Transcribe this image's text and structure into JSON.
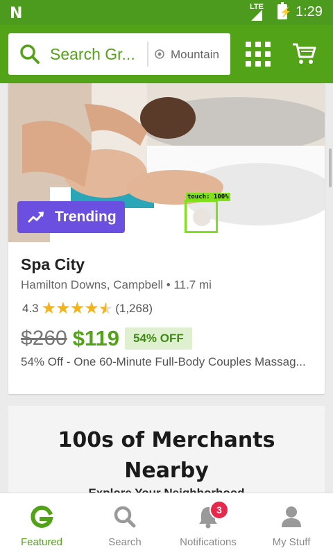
{
  "status_bar": {
    "carrier_glyph": "N",
    "network": "LTE",
    "time": "1:29"
  },
  "header": {
    "search_placeholder": "Search Gr...",
    "location": "Mountain"
  },
  "deal": {
    "badge": "Trending",
    "touch_label": "touch: 100%",
    "merchant": "Spa City",
    "location": "Hamilton Downs, Campbell • 11.7 mi",
    "rating": "4.3",
    "stars": 4.3,
    "reviews": "(1,268)",
    "original_price": "$260",
    "price": "$119",
    "discount": "54% OFF",
    "title": "54% Off - One 60-Minute Full-Body Couples Massag..."
  },
  "section": {
    "headline_line1": "100s of Merchants",
    "headline_line2": "Nearby",
    "subline": "Explore Your Neighborhood"
  },
  "bottom_nav": {
    "items": [
      {
        "label": "Featured",
        "icon": "groupon-g-icon",
        "active": true
      },
      {
        "label": "Search",
        "icon": "search-icon",
        "active": false
      },
      {
        "label": "Notifications",
        "icon": "bell-icon",
        "active": false
      },
      {
        "label": "My Stuff",
        "icon": "user-icon",
        "active": false
      }
    ],
    "notification_count": "3"
  },
  "colors": {
    "brand_green": "#53a318",
    "trending_purple": "#6b4fe0",
    "badge_red": "#e8284b",
    "star_gold": "#f5b31a"
  }
}
